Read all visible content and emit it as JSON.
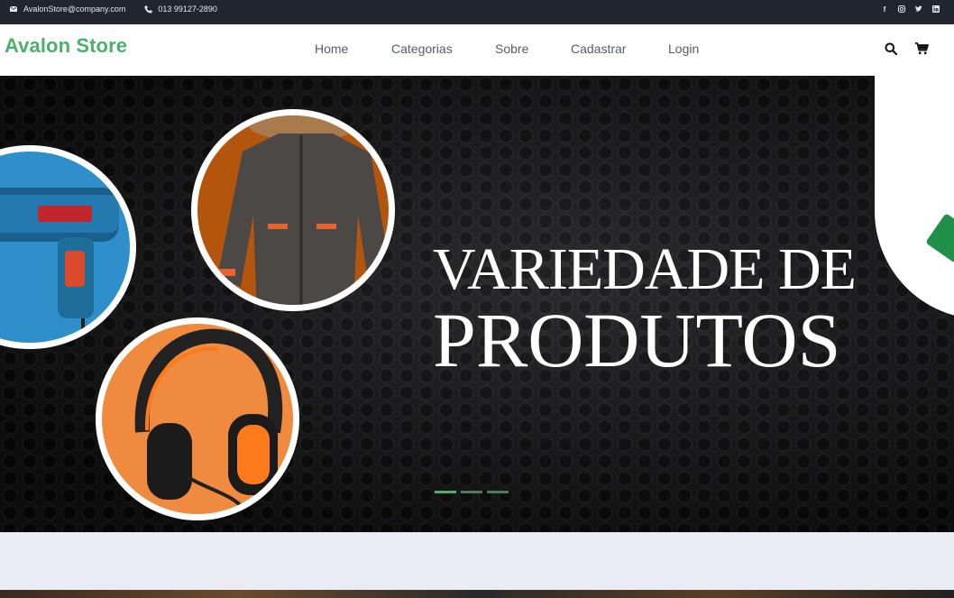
{
  "topbar": {
    "email": "AvalonStore@company.com",
    "phone": "013 99127-2890",
    "social": [
      "facebook-icon",
      "instagram-icon",
      "twitter-icon",
      "linkedin-icon"
    ]
  },
  "nav": {
    "brand": "Avalon Store",
    "items": [
      {
        "label": "Home"
      },
      {
        "label": "Categorias"
      },
      {
        "label": "Sobre"
      },
      {
        "label": "Cadastrar"
      },
      {
        "label": "Login"
      }
    ],
    "icons": [
      "search-icon",
      "cart-icon"
    ]
  },
  "hero": {
    "line1": "VARIEDADE DE",
    "line2": "PRODUTOS",
    "slides": 3,
    "active_slide": 1
  },
  "colors": {
    "brand_green": "#4caf6c",
    "topbar_bg": "#212530",
    "page_bg": "#e9ecf3"
  }
}
